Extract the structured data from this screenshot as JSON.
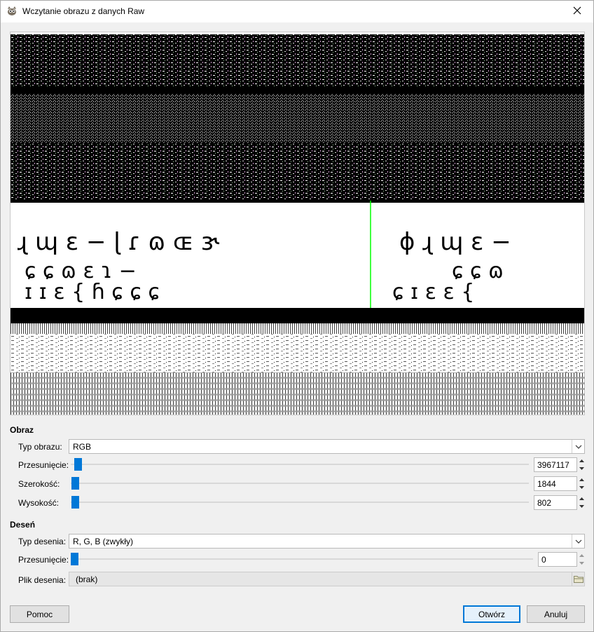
{
  "window": {
    "title": "Wczytanie obrazu z danych Raw",
    "app_icon": "gimp-icon",
    "close_icon": "close-icon"
  },
  "preview": {
    "glyph_row_1_left": "ɻ ɰ ɛ − ɭ ɾ ɷ ɶ ɝ",
    "glyph_row_2_left": "ɕ ɕ ɷ ɛ ɿ −",
    "glyph_row_3_left": "ɪ ɪ ɛ { ɦ ɕ ɕ ɕ",
    "glyph_row_1_right": "ɸ ɻ ɰ ɛ −",
    "glyph_row_2_right": "ɕ ɕ ɷ",
    "glyph_row_3_right": "ɕ ɪ ɛ ɛ {"
  },
  "image_section": {
    "title": "Obraz",
    "type_label": "Typ obrazu:",
    "type_value": "RGB",
    "offset_label": "Przesunięcie:",
    "offset_value": "3967117",
    "offset_fraction": 0.02,
    "width_label": "Szerokość:",
    "width_value": "1844",
    "width_fraction": 0.01,
    "height_label": "Wysokość:",
    "height_value": "802",
    "height_fraction": 0.01
  },
  "pattern_section": {
    "title": "Deseń",
    "type_label": "Typ desenia:",
    "type_value": "R, G, B (zwykły)",
    "offset_label": "Przesunięcie:",
    "offset_value": "0",
    "offset_fraction": 0.0,
    "file_label": "Plik desenia:",
    "file_value": "(brak)",
    "folder_icon": "folder-icon"
  },
  "buttons": {
    "help": "Pomoc",
    "open": "Otwórz",
    "cancel": "Anuluj"
  },
  "colors": {
    "accent": "#0078d7",
    "preview_line": "#00ff00"
  }
}
